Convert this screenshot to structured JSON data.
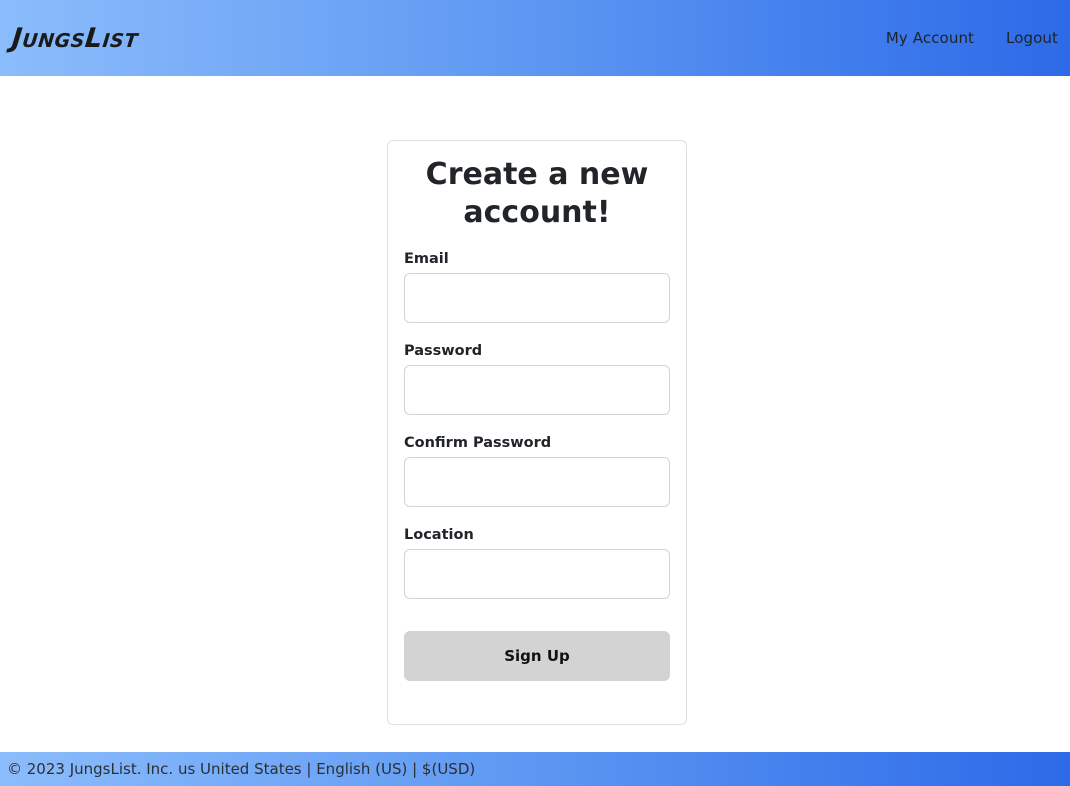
{
  "header": {
    "brand": "JungsList",
    "nav": [
      {
        "label": "My Account"
      },
      {
        "label": "Logout"
      }
    ]
  },
  "form": {
    "title": "Create a new account!",
    "fields": [
      {
        "label": "Email",
        "value": "",
        "placeholder": ""
      },
      {
        "label": "Password",
        "value": "",
        "placeholder": ""
      },
      {
        "label": "Confirm Password",
        "value": "",
        "placeholder": ""
      },
      {
        "label": "Location",
        "value": "",
        "placeholder": ""
      }
    ],
    "submit_label": "Sign Up"
  },
  "footer": {
    "text": "© 2023 JungsList. Inc. us United States | English (US) | $(USD)"
  },
  "colors": {
    "gradient_start": "#8bbcfb",
    "gradient_end": "#2c6ae8",
    "button_bg": "#d3d3d3",
    "card_border": "#dcdfe3"
  }
}
